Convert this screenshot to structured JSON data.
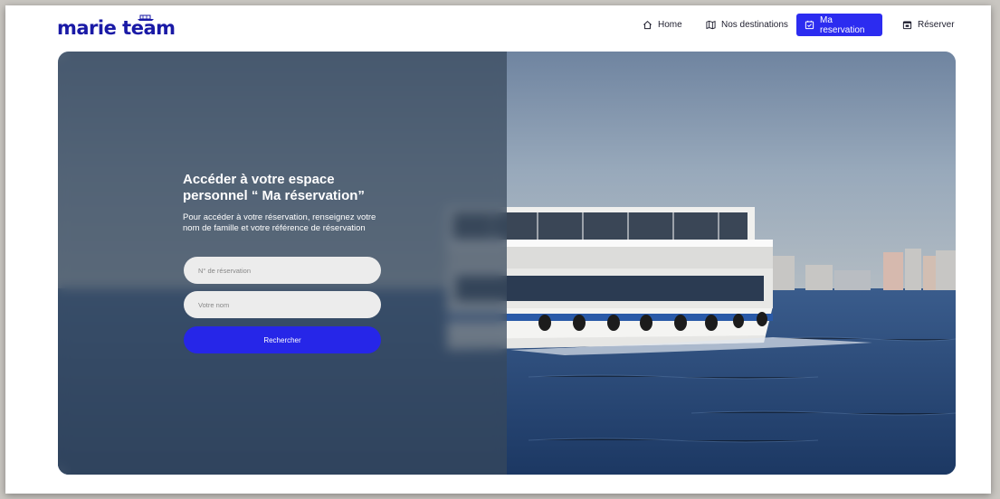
{
  "brand": {
    "name": "marie team",
    "color": "#1a1aa6"
  },
  "nav": {
    "items": [
      {
        "label": "Home",
        "icon": "home-icon"
      },
      {
        "label": "Nos destinations",
        "icon": "map-icon"
      },
      {
        "label": "Ma reservation",
        "icon": "calendar-check-icon",
        "active": true
      },
      {
        "label": "Réserver",
        "icon": "calendar-icon"
      }
    ],
    "accent": "#2c2cf0"
  },
  "hero": {
    "title": "Accéder à votre espace personnel “ Ma réservation”",
    "description": "Pour accéder à votre réservation, renseignez votre nom de famille et votre référence de réservation",
    "fields": {
      "reservation_placeholder": "N° de réservation",
      "name_placeholder": "Votre nom"
    },
    "search_label": "Rechercher",
    "button_color": "#2626e8"
  }
}
